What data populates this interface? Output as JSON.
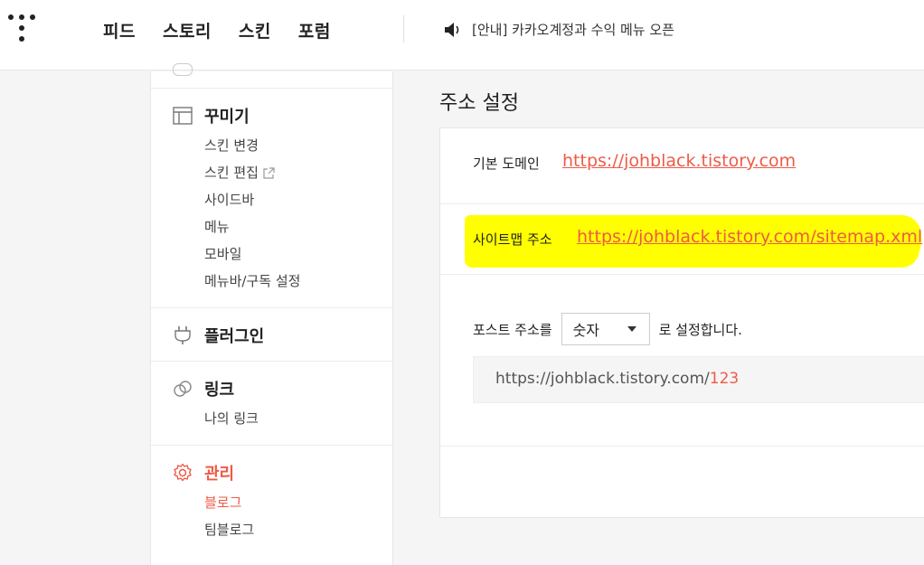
{
  "topbar": {
    "nav": [
      "피드",
      "스토리",
      "스킨",
      "포럼"
    ],
    "notice": "[안내] 카카오계정과 수익 메뉴 오픈"
  },
  "sidebar": {
    "groups": [
      {
        "title": "꾸미기",
        "icon": "layout-icon",
        "items": [
          "스킨 변경",
          "스킨 편집",
          "사이드바",
          "메뉴",
          "모바일",
          "메뉴바/구독 설정"
        ]
      },
      {
        "title": "플러그인",
        "icon": "plug-icon",
        "items": []
      },
      {
        "title": "링크",
        "icon": "link-icon",
        "items": [
          "나의 링크"
        ]
      },
      {
        "title": "관리",
        "icon": "gear-icon",
        "items": [
          "블로그",
          "팀블로그"
        ],
        "active": true,
        "active_item": "블로그"
      }
    ]
  },
  "main": {
    "title": "주소 설정",
    "default_domain_label": "기본 도메인",
    "default_domain_value": "https://johblack.tistory.com",
    "sitemap_label": "사이트맵 주소",
    "sitemap_value": "https://johblack.tistory.com/sitemap.xml",
    "post_address_prefix": "포스트 주소를",
    "post_address_select": "숫자",
    "post_address_suffix": "로 설정합니다.",
    "preview_base": "https://johblack.tistory.com/",
    "preview_id": "123"
  },
  "colors": {
    "accent": "#ee5a47",
    "highlight": "#ffff00"
  }
}
